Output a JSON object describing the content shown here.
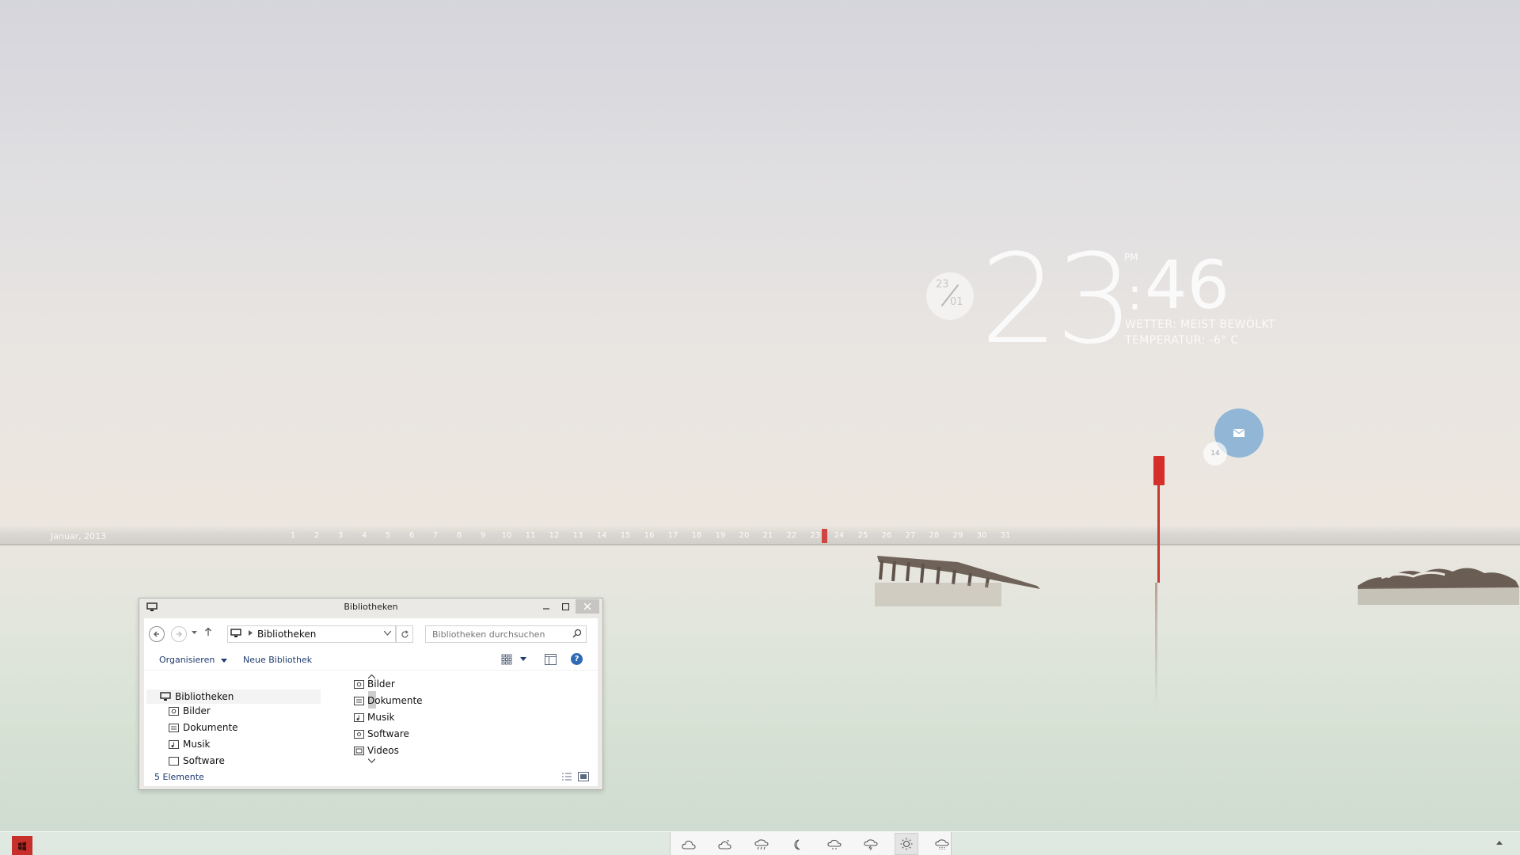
{
  "desktop": {
    "calendar": {
      "month_label": "Januar, 2013",
      "days": [
        "1",
        "2",
        "3",
        "4",
        "5",
        "6",
        "7",
        "8",
        "9",
        "10",
        "11",
        "12",
        "13",
        "14",
        "15",
        "16",
        "17",
        "18",
        "19",
        "20",
        "21",
        "22",
        "23",
        "24",
        "25",
        "26",
        "27",
        "28",
        "29",
        "30",
        "31"
      ],
      "current_day": "23",
      "marker_color": "#d0453f"
    },
    "clock": {
      "date_day": "23",
      "date_month": "01",
      "hour": "23",
      "minute": "46",
      "ampm": "PM",
      "weather_line": "WETTER: MEIST BEWÖLKT",
      "temperature_line": "TEMPERATUR: -6° C"
    },
    "mail": {
      "icon": "mail-icon",
      "count": "14",
      "color": "#92b6d6"
    }
  },
  "window": {
    "title": "Bibliotheken",
    "address": "Bibliotheken",
    "search_placeholder": "Bibliotheken durchsuchen",
    "toolbar": {
      "organize": "Organisieren",
      "new_library": "Neue Bibliothek"
    },
    "tree": {
      "root": "Bibliotheken",
      "items": [
        "Bilder",
        "Dokumente",
        "Musik",
        "Software"
      ]
    },
    "files": [
      "Bilder",
      "Dokumente",
      "Musik",
      "Software",
      "Videos"
    ],
    "status": "5 Elemente"
  },
  "taskbar": {
    "start_color": "#c72f2a",
    "weather_icons": [
      "cloud-icon",
      "partly-cloudy-icon",
      "rain-icon",
      "moon-icon",
      "cloudy-night-icon",
      "thunder-icon",
      "sun-icon",
      "snow-icon"
    ],
    "active_weather_index": 6
  }
}
